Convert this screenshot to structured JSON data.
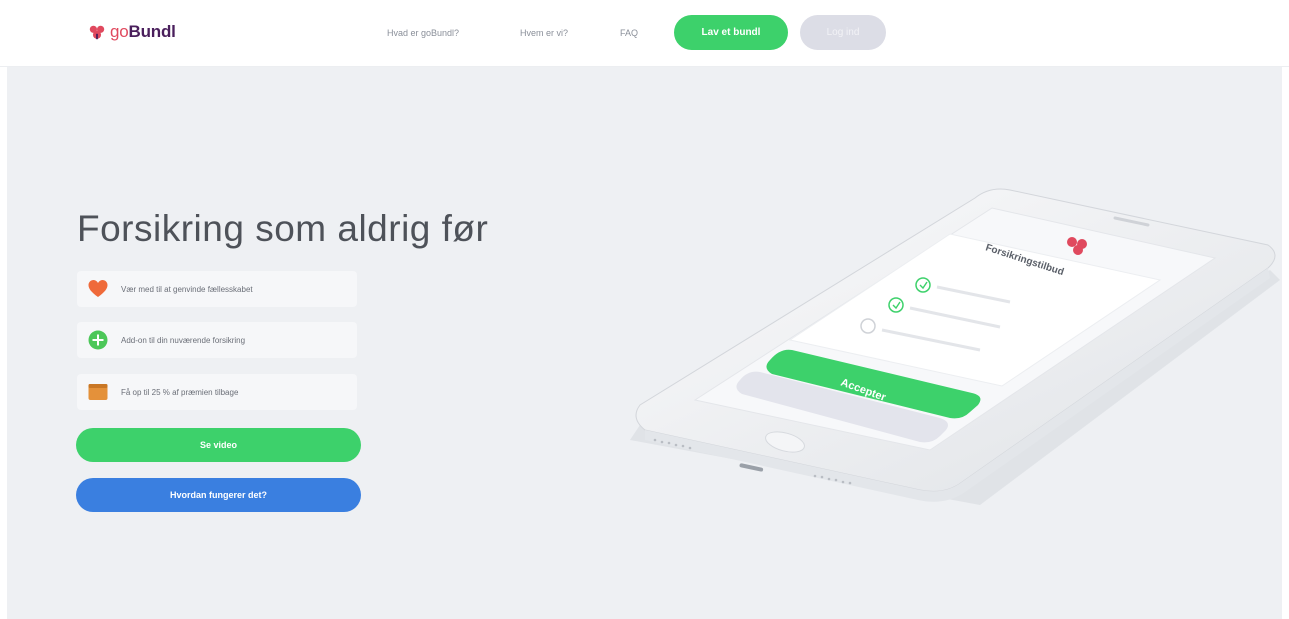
{
  "header": {
    "logo_prefix": "go",
    "logo_name": "Bundl",
    "nav": [
      "Hvad er goBundl?",
      "Hvem er vi?",
      "FAQ"
    ],
    "create_button": "Lav et bundl",
    "login_button": "Log ind"
  },
  "hero": {
    "title": "Forsikring som aldrig før",
    "features": [
      {
        "icon": "heart-icon",
        "text": "Vær med til at genvinde fællesskabet"
      },
      {
        "icon": "plus-circle-icon",
        "text": "Add-on til din nuværende forsikring"
      },
      {
        "icon": "wallet-icon",
        "text": "Få op til 25 % af præmien tilbage"
      }
    ],
    "video_button": "Se video",
    "how_button": "Hvordan fungerer det?"
  },
  "phone": {
    "screen_title": "Forsikringstilbud",
    "accept_button": "Accepter"
  },
  "colors": {
    "green": "#3dd16b",
    "blue": "#3a7fe0",
    "brand_red": "#e0495e",
    "brand_purple": "#4a1f5c",
    "hero_bg": "#eef0f3"
  }
}
